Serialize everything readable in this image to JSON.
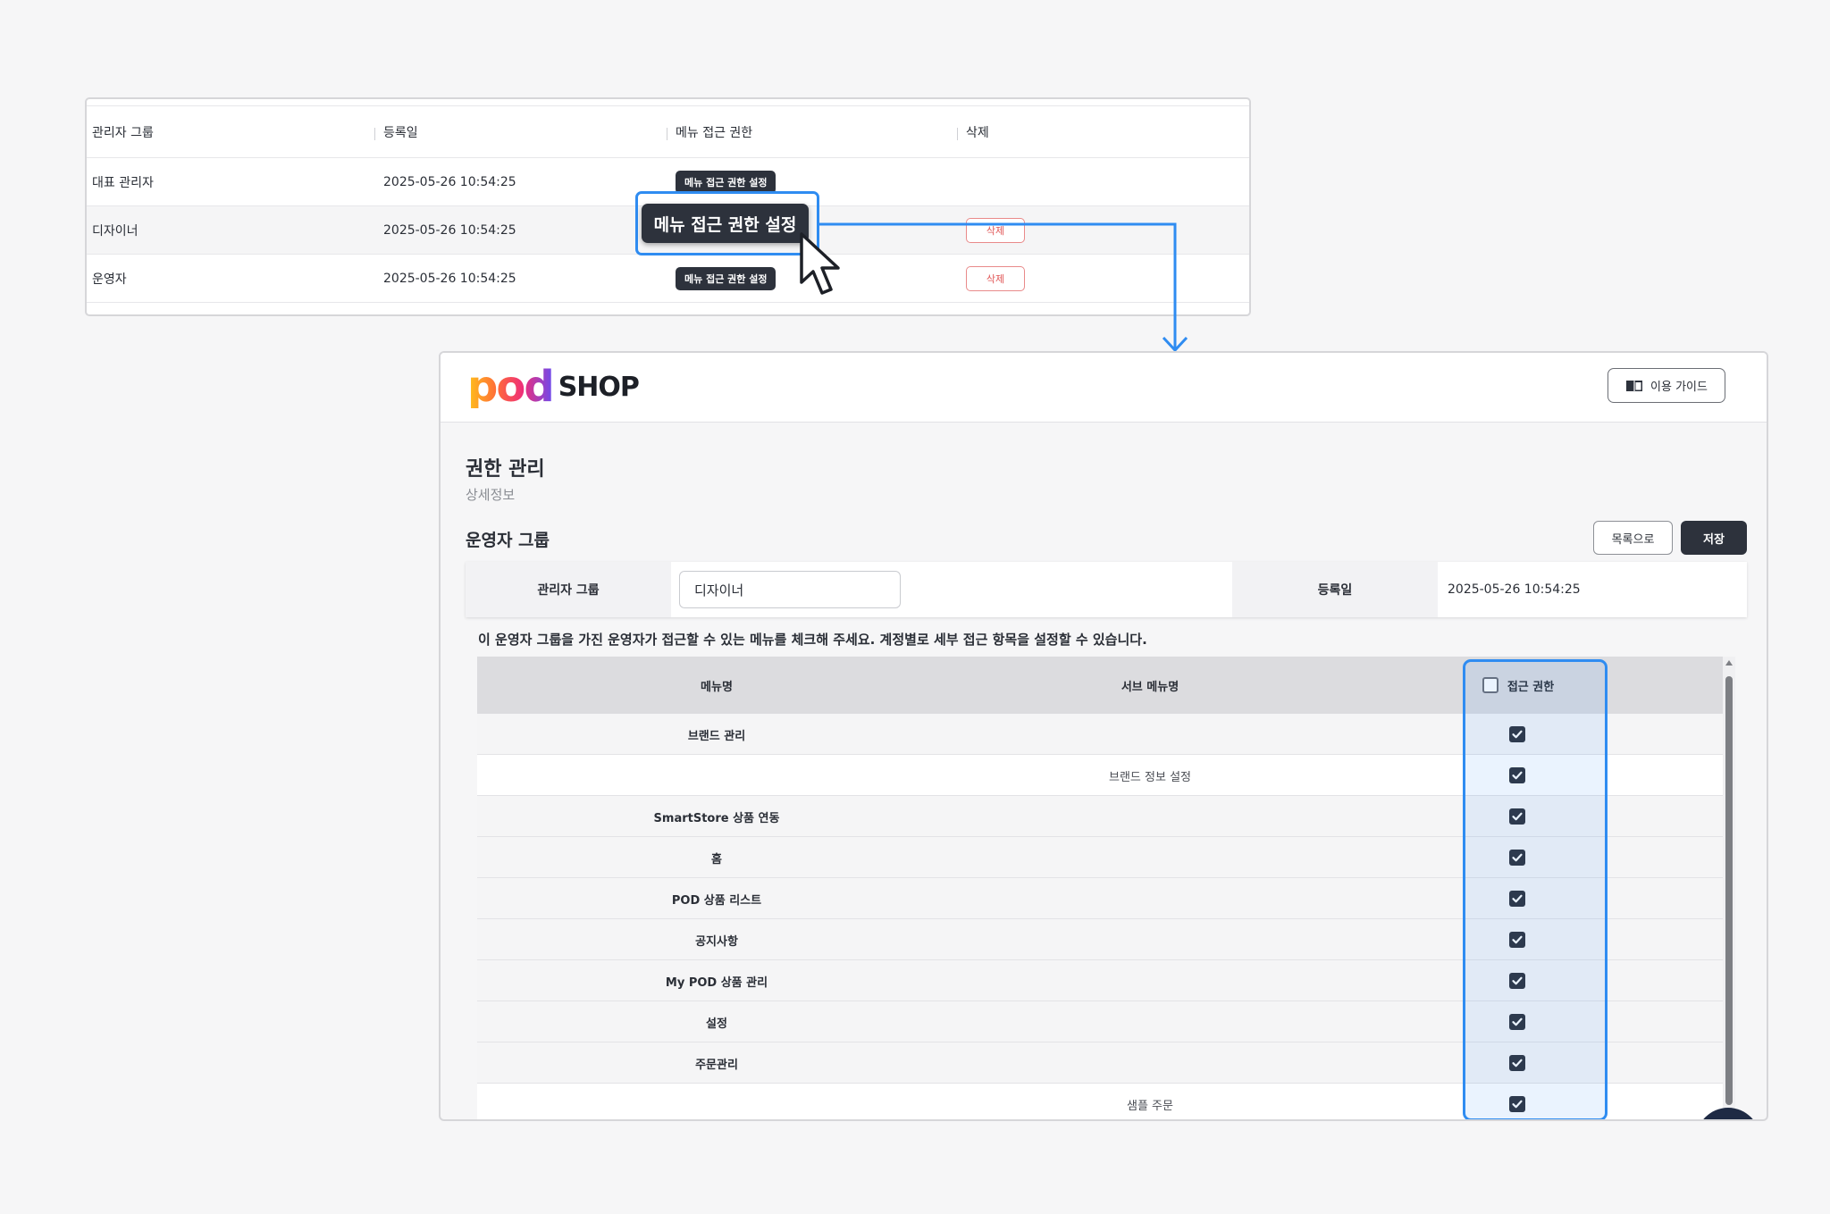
{
  "list": {
    "headers": [
      "관리자 그룹",
      "등록일",
      "메뉴 접근 권한",
      "삭제"
    ],
    "rows": [
      {
        "group": "대표 관리자",
        "date": "2025-05-26 10:54:25",
        "menu_btn": "메뉴 접근 권한 설정",
        "delete": ""
      },
      {
        "group": "디자이너",
        "date": "2025-05-26 10:54:25",
        "menu_btn": "",
        "delete": "삭제"
      },
      {
        "group": "운영자",
        "date": "2025-05-26 10:54:25",
        "menu_btn": "메뉴 접근 권한 설정",
        "delete": "삭제"
      }
    ],
    "highlighted_button": "메뉴 접근 권한 설정"
  },
  "header": {
    "logo_mark": "pod",
    "logo_text": "SHOP",
    "guide_label": "이용 가이드",
    "guide_icon": "book-icon"
  },
  "page": {
    "title": "권한 관리",
    "subtitle": "상세정보",
    "section_title": "운영자 그룹",
    "list_button": "목록으로",
    "save_button": "저장"
  },
  "info": {
    "group_label": "관리자 그룹",
    "group_value": "디자이너",
    "date_label": "등록일",
    "date_value": "2025-05-26 10:54:25"
  },
  "instruction": "이 운영자 그룹을 가진 운영자가 접근할 수 있는 메뉴를 체크해 주세요. 계정별로 세부 접근 항목을 설정할 수 있습니다.",
  "perm_table": {
    "headers": {
      "menu": "메뉴명",
      "sub": "서브 메뉴명",
      "access": "접근 권한"
    },
    "header_checked": false,
    "rows": [
      {
        "menu": "브랜드 관리",
        "sub": "",
        "checked": true
      },
      {
        "menu": "",
        "sub": "브랜드 정보 설정",
        "checked": true
      },
      {
        "menu": "SmartStore 상품 연동",
        "sub": "",
        "checked": true
      },
      {
        "menu": "홈",
        "sub": "",
        "checked": true
      },
      {
        "menu": "POD 상품 리스트",
        "sub": "",
        "checked": true
      },
      {
        "menu": "공지사항",
        "sub": "",
        "checked": true
      },
      {
        "menu": "My POD 상품 관리",
        "sub": "",
        "checked": true
      },
      {
        "menu": "설정",
        "sub": "",
        "checked": true
      },
      {
        "menu": "주문관리",
        "sub": "",
        "checked": true
      },
      {
        "menu": "",
        "sub": "샘플 주문",
        "checked": true
      }
    ]
  },
  "colors": {
    "accent": "#2f8cf1",
    "dark_button": "#2d323c",
    "delete_red": "#e05454"
  }
}
